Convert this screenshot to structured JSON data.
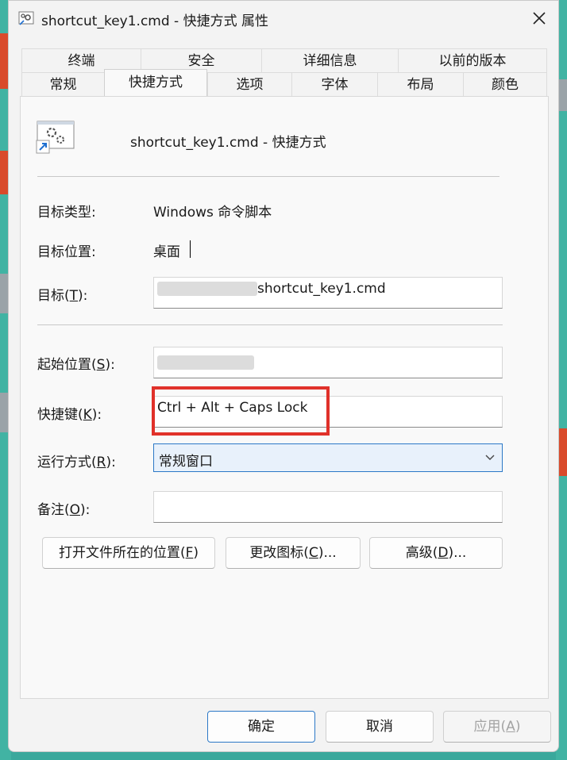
{
  "window": {
    "title": "shortcut_key1.cmd - 快捷方式 属性",
    "icon": "shortcut-gear-icon",
    "close_icon": "close-icon"
  },
  "tabs": {
    "back_row": [
      "终端",
      "安全",
      "详细信息",
      "以前的版本"
    ],
    "front_row": [
      "常规",
      "快捷方式",
      "选项",
      "字体",
      "布局",
      "颜色"
    ],
    "active": "快捷方式"
  },
  "shortcut": {
    "name": "shortcut_key1.cmd - 快捷方式",
    "target_type_label": "目标类型:",
    "target_type_value": "Windows 命令脚本",
    "target_location_label": "目标位置:",
    "target_location_value": "桌面",
    "target_label_prefix": "目标(",
    "target_label_key": "T",
    "target_label_suffix": "):",
    "target_value": "shortcut_key1.cmd",
    "start_in_label_prefix": "起始位置(",
    "start_in_label_key": "S",
    "start_in_label_suffix": "):",
    "hotkey_label_prefix": "快捷键(",
    "hotkey_label_key": "K",
    "hotkey_label_suffix": "):",
    "hotkey_value": "Ctrl + Alt + Caps Lock",
    "run_label_prefix": "运行方式(",
    "run_label_key": "R",
    "run_label_suffix": "):",
    "run_value": "常规窗口",
    "comment_label_prefix": "备注(",
    "comment_label_key": "O",
    "comment_label_suffix": "):",
    "comment_value": ""
  },
  "buttons": {
    "open_location_prefix": "打开文件所在的位置(",
    "open_location_key": "F",
    "open_location_suffix": ")",
    "change_icon_prefix": "更改图标(",
    "change_icon_key": "C",
    "change_icon_suffix": ")...",
    "advanced_prefix": "高级(",
    "advanced_key": "D",
    "advanced_suffix": ")...",
    "ok": "确定",
    "cancel": "取消",
    "apply_prefix": "应用(",
    "apply_key": "A",
    "apply_suffix": ")"
  },
  "colors": {
    "accent": "#2c78c7",
    "highlight_box": "#e0312a",
    "select_bg": "#e8f1fb"
  }
}
